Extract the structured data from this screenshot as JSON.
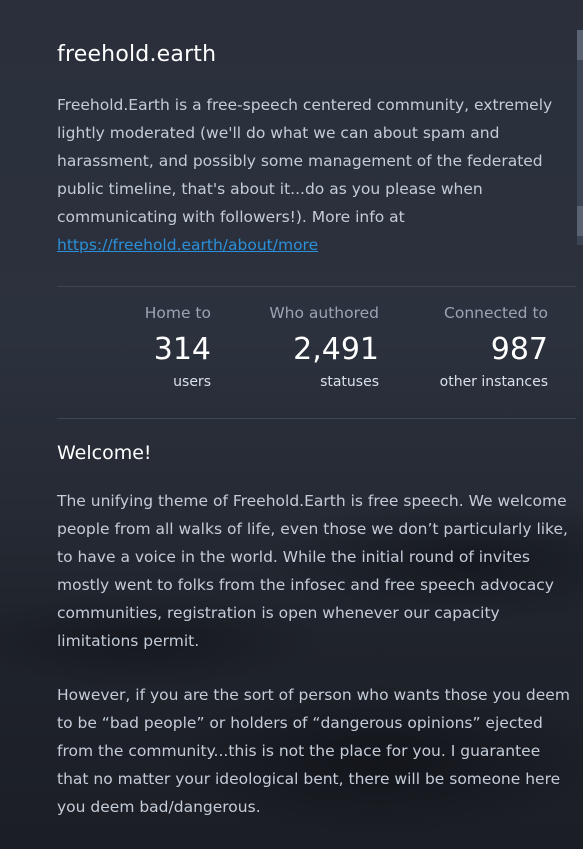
{
  "site": {
    "title": "freehold.earth",
    "description": "Freehold.Earth is a free-speech centered community, extremely lightly moderated (we'll do what we can about spam and harassment, and possibly some management of the federated public timeline, that's about it...do as you please when communicating with followers!). More info at ",
    "more_info_link": "https://freehold.earth/about/more"
  },
  "stats": {
    "users": {
      "top": "Home to",
      "value": "314",
      "bottom": "users"
    },
    "statuses": {
      "top": "Who authored",
      "value": "2,491",
      "bottom": "statuses"
    },
    "instances": {
      "top": "Connected to",
      "value": "987",
      "bottom": "other instances"
    }
  },
  "welcome": {
    "heading": "Welcome!",
    "paragraph1": "The unifying theme of Freehold.Earth is free speech. We welcome people from all walks of life, even those we don’t particularly like, to have a voice in the world. While the initial round of invites mostly went to folks from the infosec and free speech advocacy communities, registration is open whenever our capacity limitations permit.",
    "paragraph2": "However, if you are the sort of person who wants those you deem to be “bad people” or holders of “dangerous opinions” ejected from the community...this is not the place for you. I guarantee that no matter your ideological bent, there will be someone here you deem bad/dangerous."
  },
  "colors": {
    "background": "#282c37",
    "link": "#2b90d9",
    "text_primary": "#ffffff",
    "text_secondary": "#c4ccd8",
    "text_muted": "#9aa4b4"
  }
}
